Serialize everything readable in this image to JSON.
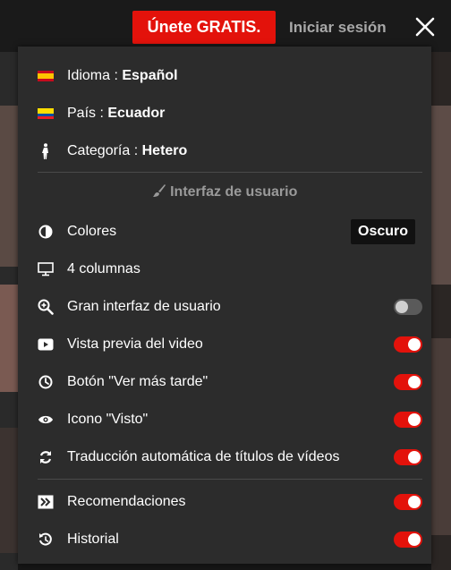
{
  "header": {
    "join_label": "Únete GRATIS.",
    "login_label": "Iniciar sesión",
    "close_icon": "close-icon"
  },
  "menu": {
    "language": {
      "prefix": "Idioma : ",
      "value": "Español",
      "icon": "spain-flag-icon"
    },
    "country": {
      "prefix": "País : ",
      "value": "Ecuador",
      "icon": "ecuador-flag-icon"
    },
    "category": {
      "prefix": "Categoría : ",
      "value": "Hetero",
      "icon": "male-figure-icon"
    },
    "ui_section_title": "Interfaz de usuario",
    "colors": {
      "label": "Colores",
      "value": "Oscuro",
      "icon": "contrast-icon"
    },
    "columns": {
      "label": "4 columnas",
      "icon": "monitor-icon"
    },
    "big_ui": {
      "label": "Gran interfaz de usuario",
      "enabled": false,
      "icon": "zoom-icon"
    },
    "video_preview": {
      "label": "Vista previa del video",
      "enabled": true,
      "icon": "play-icon"
    },
    "watch_later": {
      "label": "Botón \"Ver más tarde\"",
      "enabled": true,
      "icon": "clock-icon"
    },
    "watched_icon": {
      "label": "Icono \"Visto\"",
      "enabled": true,
      "icon": "eye-icon"
    },
    "auto_translate": {
      "label": "Traducción automática de títulos de vídeos",
      "enabled": true,
      "icon": "refresh-icon"
    },
    "recommendations": {
      "label": "Recomendaciones",
      "enabled": true,
      "icon": "recommendations-icon"
    },
    "history": {
      "label": "Historial",
      "enabled": true,
      "icon": "history-icon"
    }
  },
  "colors": {
    "accent": "#e3120b",
    "panel_bg": "#2c2c2c",
    "muted_text": "#9a9a9a"
  }
}
